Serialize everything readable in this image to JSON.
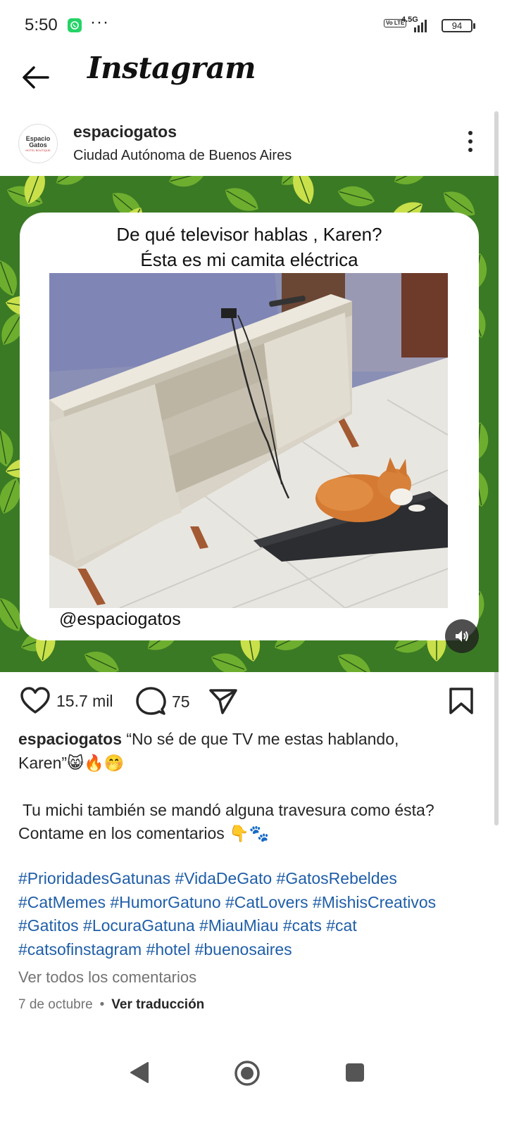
{
  "status_bar": {
    "time": "5:50",
    "more_dots": "···",
    "volte": "Vo LTE",
    "network": "4.5G",
    "battery": "94"
  },
  "header": {
    "brand": "Instagram"
  },
  "post": {
    "username": "espaciogatos",
    "location": "Ciudad Autónoma de Buenos Aires",
    "avatar_line1": "Espacio",
    "avatar_line2": "Gatos",
    "avatar_line3": "HOTEL BOUTIQUE",
    "media": {
      "caption_line1": "De qué televisor hablas , Karen?",
      "caption_line2": "Ésta es mi camita eléctrica",
      "watermark": "@espaciogatos"
    },
    "likes": "15.7 mil",
    "comments": "75",
    "caption_user": "espaciogatos",
    "caption_line1": "“No sé de que TV me estas hablando,",
    "caption_line2": "Karen”😸🔥🤭",
    "caption_line3": " Tu michi también se mandó alguna travesura como ésta?",
    "caption_line4": "Contame en los comentarios 👇🐾",
    "hashtags_line1": "#PrioridadesGatunas #VidaDeGato #GatosRebeldes",
    "hashtags_line2": "#CatMemes #HumorGatuno #CatLovers #MishisCreativos",
    "hashtags_line3": "#Gatitos #LocuraGatuna #MiauMiau #cats #cat",
    "hashtags_line4": "#catsofinstagram #hotel #buenosaires",
    "view_all_comments": "Ver todos los comentarios",
    "date": "7 de octubre",
    "separator": "•",
    "translate": "Ver traducción"
  },
  "colors": {
    "hashtag": "#1f5ea8",
    "muted": "#737373",
    "text": "#262626",
    "leaf_green": "#3f7d28"
  }
}
